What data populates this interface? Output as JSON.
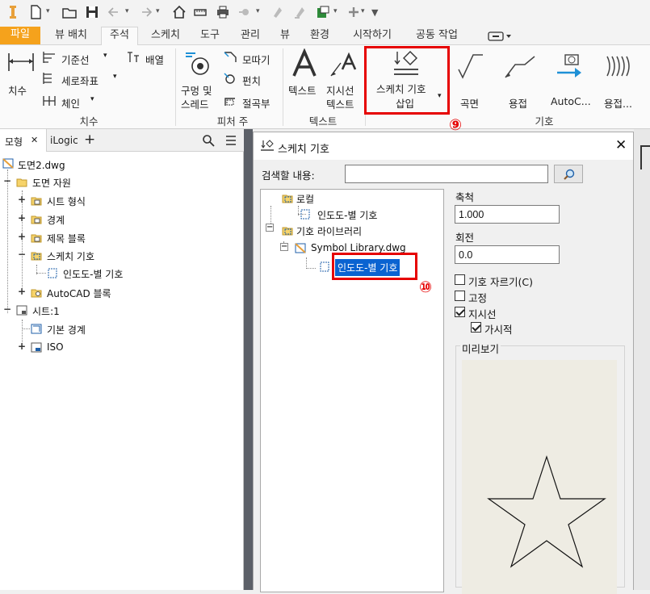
{
  "qat": {
    "icons": [
      "inventor-logo-icon",
      "new-icon",
      "open-icon",
      "save-icon",
      "undo-icon",
      "redo-icon",
      "home-icon",
      "measure-icon",
      "print-icon",
      "appearance-icon",
      "update-icon",
      "update-all-icon",
      "export-icon",
      "add-icon",
      "customize-icon"
    ]
  },
  "tabs": {
    "file": "파일",
    "items": [
      "뷰 배치",
      "주석",
      "스케치",
      "도구",
      "관리",
      "뷰",
      "환경",
      "시작하기",
      "공동 작업"
    ],
    "active": "주석"
  },
  "ribbon": {
    "dimension": {
      "big_label": "치수",
      "baseline": "기준선",
      "ordinate": "세로좌표",
      "chain": "체인",
      "arrange": "배열",
      "group": "치수"
    },
    "feature_notes": {
      "hole_thread_line1": "구멍 및",
      "hole_thread_line2": "스레드",
      "chamfer": "모따기",
      "punch": "펀치",
      "bend": "절곡부",
      "group": "피처 주"
    },
    "text": {
      "text": "텍스트",
      "leader_line1": "지시선",
      "leader_line2": "텍스트",
      "group": "텍스트"
    },
    "symbols": {
      "sketch_symbol_line1": "스케치 기호",
      "sketch_symbol_line2": "삽입",
      "surface": "곡면",
      "weld": "용접",
      "autocad": "AutoC...",
      "weld2": "용접...",
      "group": "기호"
    },
    "badge_9": "⑨"
  },
  "browser": {
    "tab_model": "모형",
    "tab_ilogic": "iLogic",
    "tree": {
      "root": "도면2.dwg",
      "drawing_resources": "도면 자원",
      "sheet_formats": "시트 형식",
      "borders": "경계",
      "title_blocks": "제목 블록",
      "sketch_symbols": "스케치 기호",
      "sketch_symbol_child": "인도도-별 기호",
      "autocad_blocks": "AutoCAD 블록",
      "sheet": "시트:1",
      "default_border": "기본 경계",
      "iso": "ISO"
    }
  },
  "dialog": {
    "title": "스케치 기호",
    "search_label": "검색할 내용:",
    "search_value": "",
    "tree": {
      "local": "로컬",
      "local_child": "인도도-별 기호",
      "library": "기호 라이브러리",
      "library_file": "Symbol Library.dwg",
      "library_child": "인도도-별 기호"
    },
    "scale_label": "축척",
    "scale_value": "1.000",
    "rotation_label": "회전",
    "rotation_value": "0.0",
    "clip_label": "기호 자르기(C)",
    "fixed_label": "고정",
    "leader_label": "지시선",
    "visible_label": "가시적",
    "preview_label": "미리보기",
    "badge_10": "⑩",
    "colors": {
      "selection": "#0a63d1",
      "highlight": "#e60000",
      "preview_bg": "#eeece3"
    }
  }
}
